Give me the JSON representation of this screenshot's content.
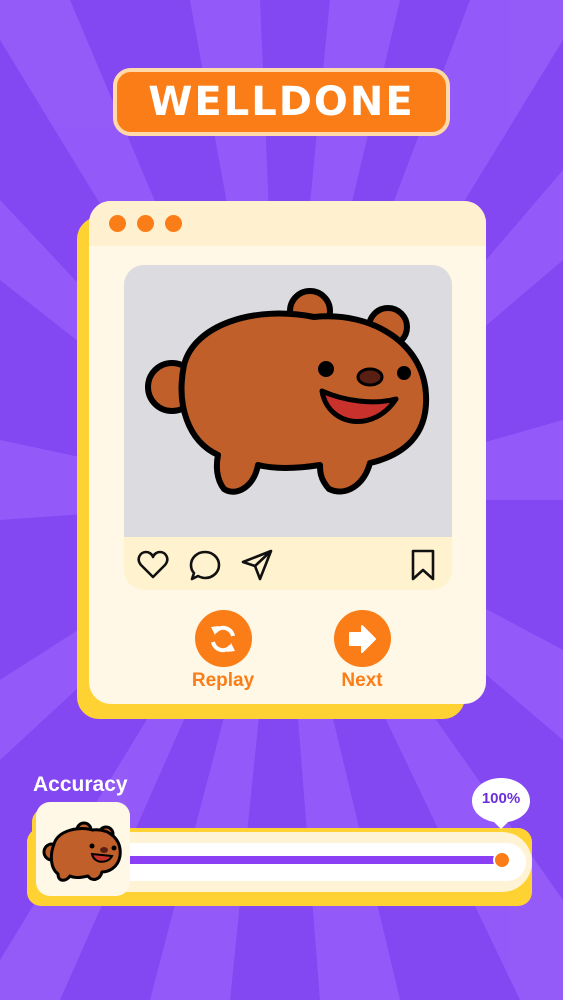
{
  "title": "WELLDONE",
  "window_dots": [
    "dot",
    "dot",
    "dot"
  ],
  "post": {
    "image": "brown-bear-cartoon",
    "actions": [
      "heart-icon",
      "comment-icon",
      "share-icon",
      "bookmark-icon"
    ]
  },
  "buttons": {
    "replay_label": "Replay",
    "next_label": "Next"
  },
  "accuracy": {
    "label": "Accuracy",
    "value_text": "100%",
    "value": 1.0
  },
  "colors": {
    "background": "#8a4ef7",
    "accent": "#fb7d17",
    "card": "#fff8e6",
    "card_shadow": "#ffd234",
    "progress": "#8a3ff4",
    "bear": "#c05f2a"
  }
}
